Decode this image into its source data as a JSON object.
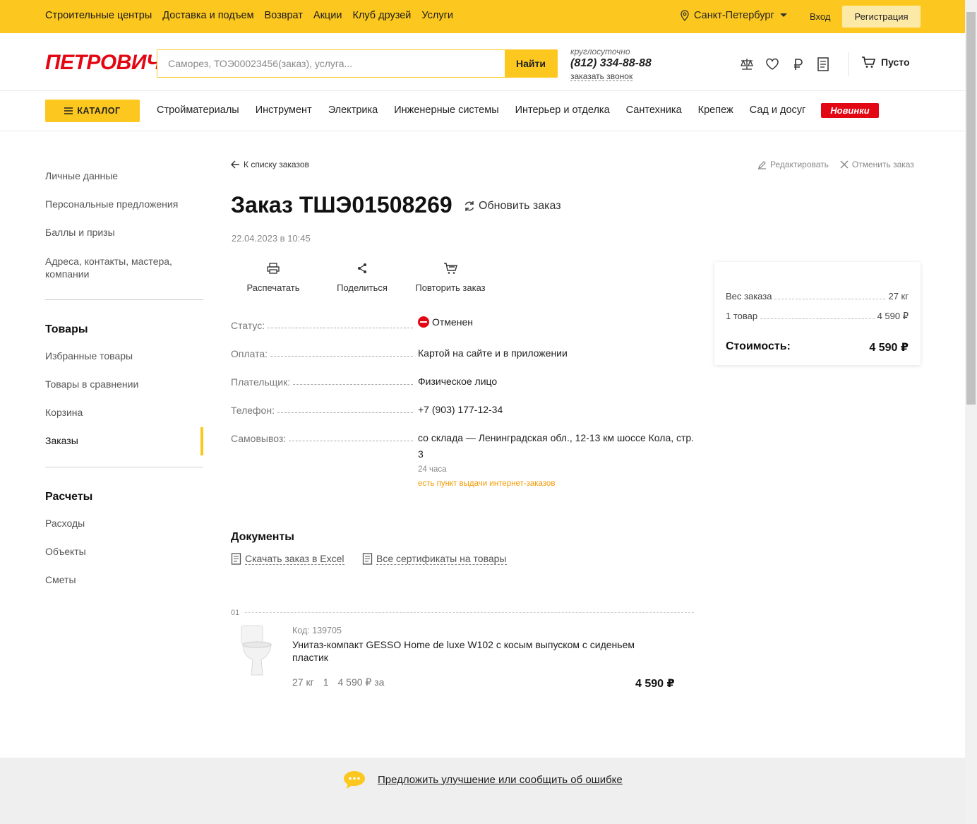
{
  "topbar": {
    "links": [
      "Строительные центры",
      "Доставка и подъем",
      "Возврат",
      "Акции",
      "Клуб друзей",
      "Услуги"
    ],
    "city": "Санкт-Петербург",
    "login": "Вход",
    "register": "Регистрация"
  },
  "header": {
    "logo": "ПЕТРОВИЧ",
    "search_placeholder": "Саморез, ТОЭ00023456(заказ), услуга...",
    "search_button": "Найти",
    "phone_note": "круглосуточно",
    "phone": "(812) 334-88-88",
    "call_link": "заказать звонок",
    "cart_label": "Пусто"
  },
  "nav": {
    "catalog": "КАТАЛОГ",
    "items": [
      "Стройматериалы",
      "Инструмент",
      "Электрика",
      "Инженерные системы",
      "Интерьер и отделка",
      "Сантехника",
      "Крепеж",
      "Сад и досуг"
    ],
    "new_badge": "Новинки"
  },
  "sidebar": {
    "top_items": [
      "Личные данные",
      "Персональные предложения",
      "Баллы и призы"
    ],
    "addresses": [
      "Адреса, контакты, мастера,",
      "компании"
    ],
    "goods_header": "Товары",
    "goods_items": [
      "Избранные товары",
      "Товары в сравнении",
      "Корзина",
      "Заказы"
    ],
    "calc_header": "Расчеты",
    "calc_items": [
      "Расходы",
      "Объекты",
      "Сметы"
    ]
  },
  "order": {
    "back": "К списку заказов",
    "edit": "Редактировать",
    "cancel": "Отменить заказ",
    "title": "Заказ ТШЭ01508269",
    "refresh": "Обновить заказ",
    "date": "22.04.2023 в 10:45",
    "tools": [
      "Распечатать",
      "Поделиться",
      "Повторить заказ"
    ],
    "fields": {
      "status_label": "Статус:",
      "status_value": "Отменен",
      "payment_label": "Оплата:",
      "payment_value": "Картой на сайте и в приложении",
      "payer_label": "Плательщик:",
      "payer_value": "Физическое лицо",
      "phone_label": "Телефон:",
      "phone_value": "+7 (903) 177-12-34",
      "pickup_label": "Самовывоз:",
      "pickup_value": "со склада — Ленинградская обл., 12-13 км шоссе Кола, стр. 3",
      "pickup_time": "24 часа",
      "pickup_note": "есть пункт выдачи интернет-заказов"
    }
  },
  "summary": {
    "weight_label": "Вес заказа",
    "weight_value": "27 кг",
    "items_label": "1 товар",
    "items_value": "4 590 ₽",
    "total_label": "Стоимость:",
    "total_value": "4 590 ₽"
  },
  "documents": {
    "title": "Документы",
    "excel": "Скачать заказ в Excel",
    "certs": "Все сертификаты на товары"
  },
  "product": {
    "index": "01",
    "code": "Код: 139705",
    "name": "Унитаз-компакт GESSO Home de luxe W102 с косым выпуском с сиденьем пластик",
    "weight": "27 кг",
    "qty": "1",
    "unit_price": "4 590 ₽ за",
    "total": "4 590 ₽"
  },
  "footer": {
    "feedback": "Предложить улучшение или сообщить об ошибке"
  },
  "colors": {
    "brand_yellow": "#fcc820",
    "brand_red": "#e30613",
    "note_orange": "#f29a00"
  }
}
